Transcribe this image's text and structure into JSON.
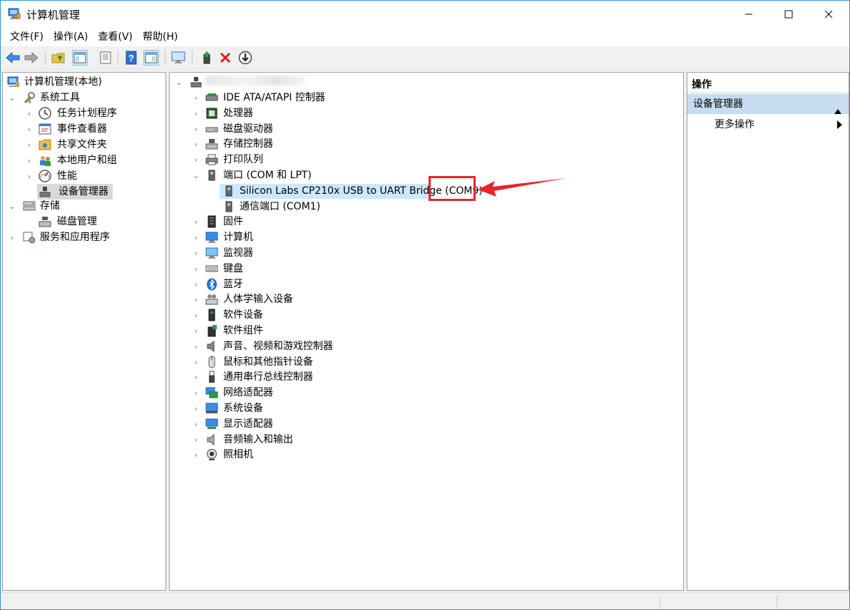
{
  "window": {
    "title": "计算机管理"
  },
  "menu": [
    "文件(F)",
    "操作(A)",
    "查看(V)",
    "帮助(H)"
  ],
  "left_tree": {
    "root": "计算机管理(本地)",
    "system_tools": "系统工具",
    "task_scheduler": "任务计划程序",
    "event_viewer": "事件查看器",
    "shared_folders": "共享文件夹",
    "local_users": "本地用户和组",
    "performance": "性能",
    "device_manager": "设备管理器",
    "storage": "存储",
    "disk_management": "磁盘管理",
    "services_apps": "服务和应用程序"
  },
  "device_tree": {
    "categories": [
      "IDE ATA/ATAPI 控制器",
      "处理器",
      "磁盘驱动器",
      "存储控制器",
      "打印队列",
      "端口 (COM 和 LPT)",
      "固件",
      "计算机",
      "监视器",
      "键盘",
      "蓝牙",
      "人体学输入设备",
      "软件设备",
      "软件组件",
      "声音、视频和游戏控制器",
      "鼠标和其他指针设备",
      "通用串行总线控制器",
      "网络适配器",
      "系统设备",
      "显示适配器",
      "音频输入和输出",
      "照相机"
    ],
    "ports": [
      "Silicon Labs CP210x USB to UART Bridge (COM9)",
      "通信端口 (COM1)"
    ]
  },
  "actions": {
    "header": "操作",
    "section": "设备管理器",
    "more": "更多操作"
  },
  "colors": {
    "highlight": "#e8242c",
    "selection": "#cce8ff",
    "action_section": "#c7dcf0"
  }
}
